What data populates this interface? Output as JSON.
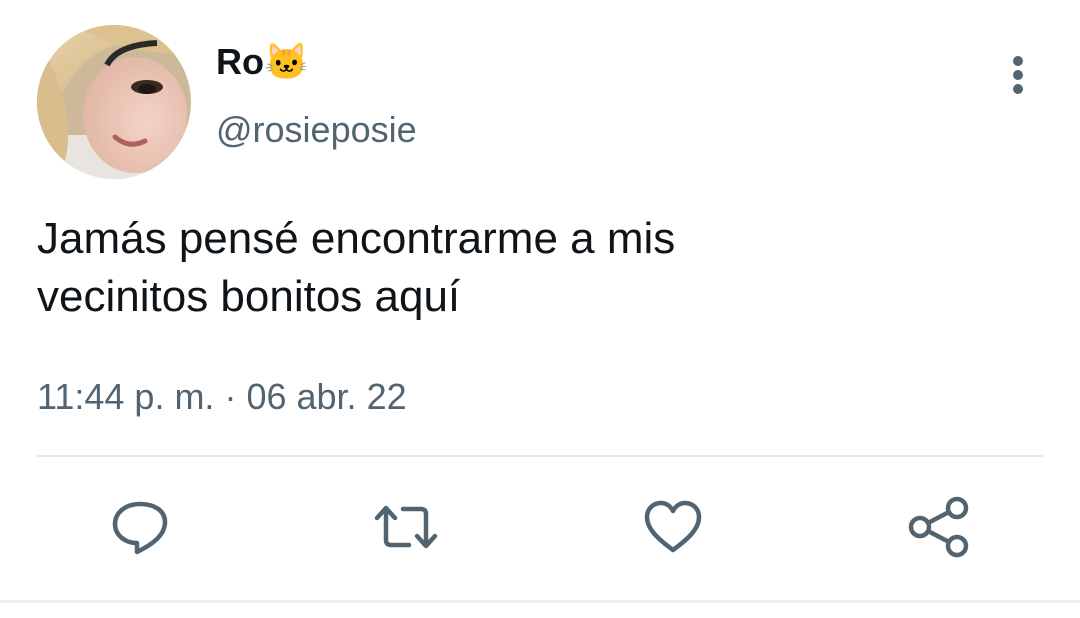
{
  "author": {
    "display_name": "Ro🐱",
    "handle": "@rosieposie",
    "avatar_icon": "profile-photo"
  },
  "tweet": {
    "text": "Jamás pensé encontrarme a mis\nvecinitos bonitos aquí",
    "time": "11:44 p. m.",
    "separator": "·",
    "date": "06 abr. 22"
  },
  "actions": [
    {
      "icon": "reply-icon"
    },
    {
      "icon": "retweet-icon"
    },
    {
      "icon": "like-icon"
    },
    {
      "icon": "share-icon"
    }
  ],
  "menu": {
    "icon": "more-vertical-icon"
  },
  "colors": {
    "text_primary": "#0f1419",
    "text_secondary": "#536471",
    "divider": "#e6e9eb"
  }
}
